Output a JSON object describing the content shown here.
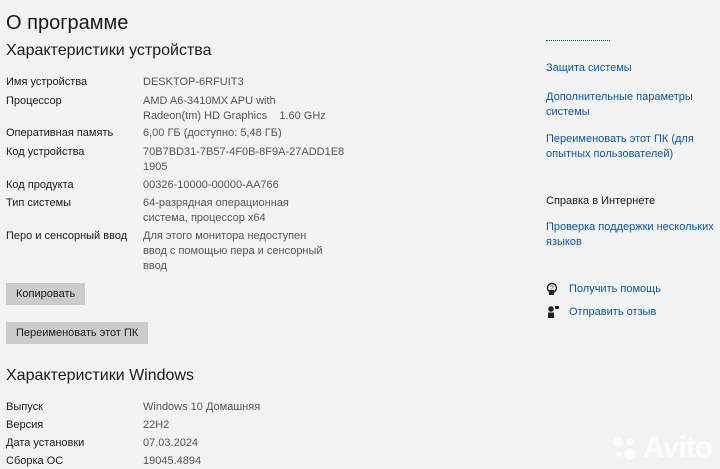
{
  "page": {
    "title": "О программе"
  },
  "device_specs": {
    "heading": "Характеристики устройства",
    "rows": [
      {
        "label": "Имя устройства",
        "value": "DESKTOP-6RFUIT3"
      },
      {
        "label": "Процессор",
        "value_line1": "AMD A6-3410MX APU with",
        "value_line2": "Radeon(tm) HD Graphics    1.60 GHz"
      },
      {
        "label": "Оперативная память",
        "value": "6,00 ГБ (доступно: 5,48 ГБ)"
      },
      {
        "label": "Код устройства",
        "value_line1": "70B7BD31-7B57-4F0B-8F9A-27ADD1E8",
        "value_line2": "1905"
      },
      {
        "label": "Код продукта",
        "value": "00326-10000-00000-AA766"
      },
      {
        "label": "Тип системы",
        "value_line1": "64-разрядная операционная",
        "value_line2": "система, процессор x64"
      },
      {
        "label": "Перо и сенсорный ввод",
        "value_line1": "Для этого монитора недоступен",
        "value_line2": "ввод с помощью пера и сенсорный",
        "value_line3": "ввод"
      }
    ],
    "copy_button": "Копировать",
    "rename_button": "Переименовать этот ПК"
  },
  "windows_specs": {
    "heading": "Характеристики Windows",
    "rows": [
      {
        "label": "Выпуск",
        "value": "Windows 10 Домашняя"
      },
      {
        "label": "Версия",
        "value": "22H2"
      },
      {
        "label": "Дата установки",
        "value": "07.03.2024"
      },
      {
        "label": "Сборка ОС",
        "value": "19045.4894"
      }
    ]
  },
  "related": {
    "links": [
      "Защита системы",
      "Дополнительные параметры",
      "системы",
      "Переименовать этот ПК (для",
      "опытных пользователей)"
    ]
  },
  "online_help": {
    "heading": "Справка в Интернете",
    "link_line1": "Проверка поддержки нескольких",
    "link_line2": "языков"
  },
  "help": {
    "get_help": "Получить помощь",
    "feedback": "Отправить отзыв"
  },
  "watermark": {
    "text": "Avito"
  },
  "colors": {
    "background": "#f3f3f3",
    "link": "#0b57a3",
    "button": "#cccccc"
  }
}
